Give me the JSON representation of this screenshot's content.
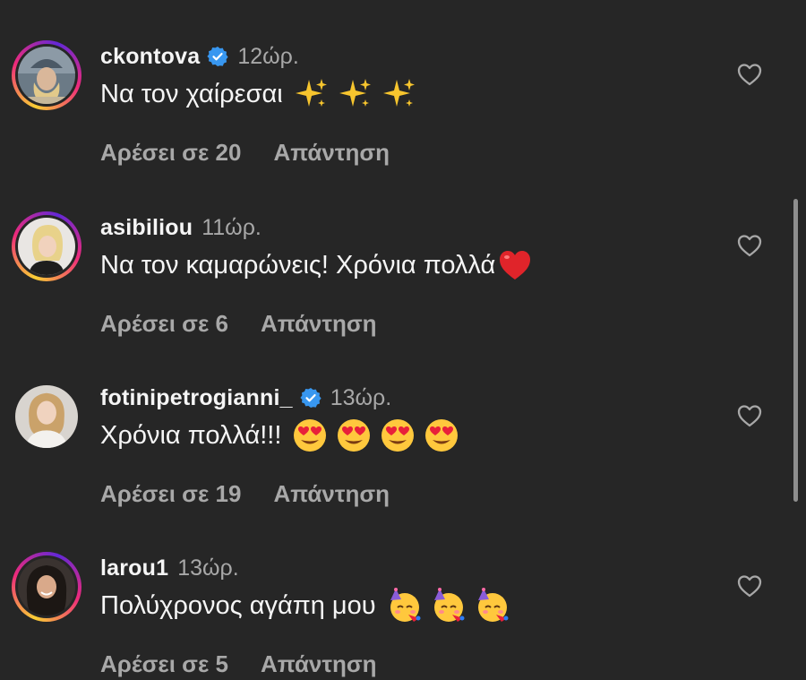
{
  "comments": [
    {
      "username": "ckontova",
      "verified": true,
      "time": "12ώρ.",
      "text": "Να τον χαίρεσαι",
      "emojis": [
        "sparkles-icon",
        "sparkles-icon",
        "sparkles-icon"
      ],
      "likes": "Αρέσει σε 20",
      "reply": "Απάντηση",
      "story_ring": true
    },
    {
      "username": "asibiliou",
      "verified": false,
      "time": "11ώρ.",
      "text": "Να τον καμαρώνεις! Χρόνια πολλά",
      "emojis": [
        "red-heart-icon"
      ],
      "likes": "Αρέσει σε 6",
      "reply": "Απάντηση",
      "story_ring": true
    },
    {
      "username": "fotinipetrogianni_",
      "verified": true,
      "time": "13ώρ.",
      "text": "Χρόνια πολλά!!!",
      "emojis": [
        "heart-eyes-icon",
        "heart-eyes-icon",
        "heart-eyes-icon",
        "heart-eyes-icon"
      ],
      "likes": "Αρέσει σε 19",
      "reply": "Απάντηση",
      "story_ring": false
    },
    {
      "username": "larou1",
      "verified": false,
      "time": "13ώρ.",
      "text": "Πολύχρονος αγάπη μου",
      "emojis": [
        "partying-face-icon",
        "partying-face-icon",
        "partying-face-icon"
      ],
      "likes": "Αρέσει σε 5",
      "reply": "Απάντηση",
      "story_ring": true
    }
  ],
  "colors": {
    "background": "#262626",
    "primary_text": "#f5f5f5",
    "secondary_text": "#a8a8a8",
    "verified_blue": "#3897f0"
  }
}
